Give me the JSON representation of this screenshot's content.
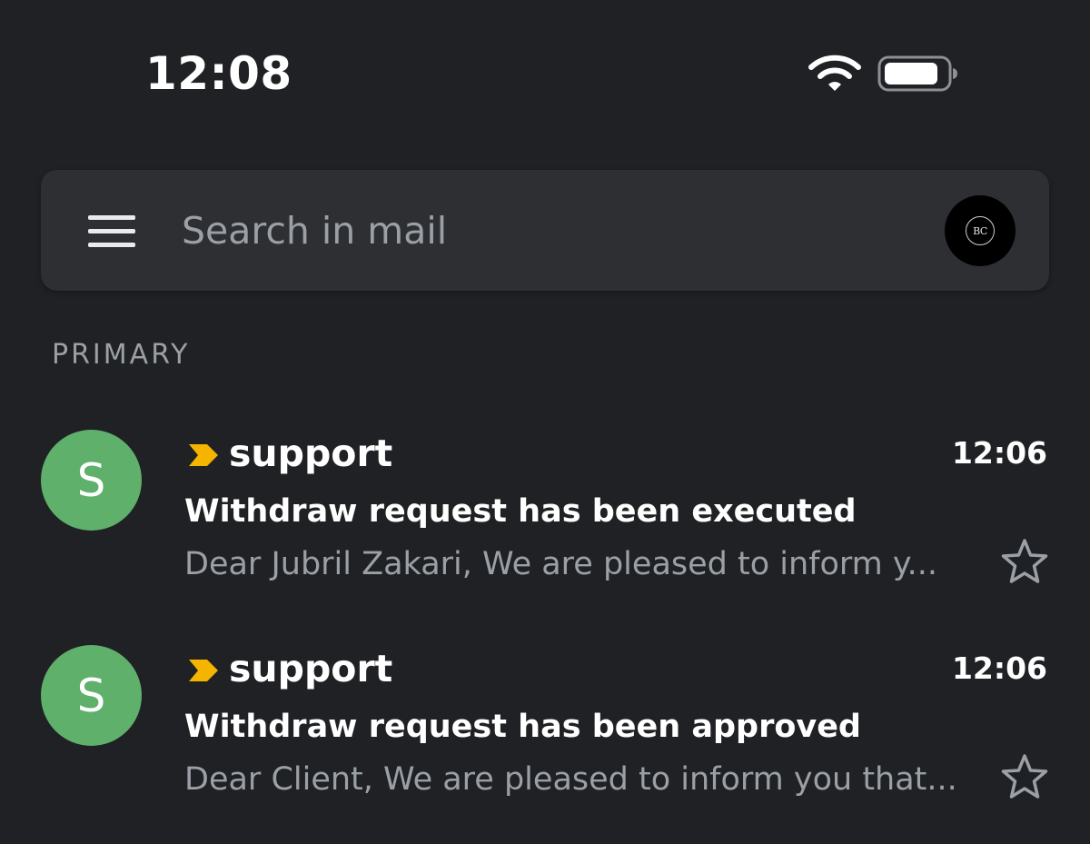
{
  "status_bar": {
    "time": "12:08",
    "wifi_icon": "wifi-icon",
    "battery_icon": "battery-icon"
  },
  "search": {
    "menu_icon": "menu-icon",
    "placeholder": "Search in mail",
    "value": "",
    "account_initials": "BC"
  },
  "section": {
    "label": "PRIMARY"
  },
  "messages": [
    {
      "avatar_letter": "S",
      "avatar_color": "#5fb06b",
      "importance_color": "#f4b400",
      "sender": "support",
      "time": "12:06",
      "subject": "Withdraw request has been executed",
      "snippet": "Dear Jubril Zakari, We are pleased to inform y...",
      "starred": false
    },
    {
      "avatar_letter": "S",
      "avatar_color": "#5fb06b",
      "importance_color": "#f4b400",
      "sender": "support",
      "time": "12:06",
      "subject": "Withdraw request has been approved",
      "snippet": "Dear Client, We are pleased to inform you that...",
      "starred": false
    }
  ]
}
